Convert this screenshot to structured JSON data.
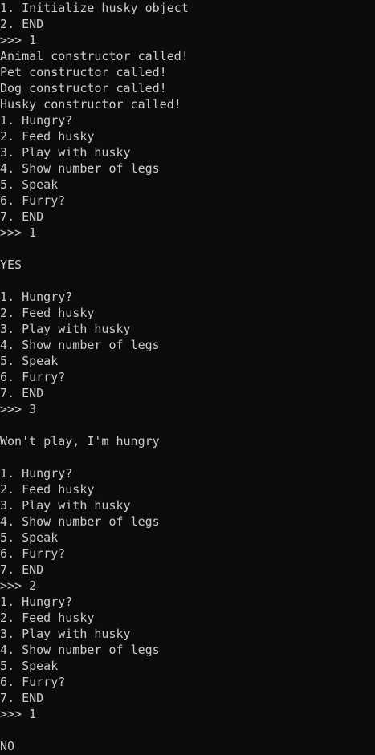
{
  "console": {
    "lines": [
      "1. Initialize husky object",
      "2. END",
      ">>> 1",
      "Animal constructor called!",
      "Pet constructor called!",
      "Dog constructor called!",
      "Husky constructor called!",
      "1. Hungry?",
      "2. Feed husky",
      "3. Play with husky",
      "4. Show number of legs",
      "5. Speak",
      "6. Furry?",
      "7. END",
      ">>> 1",
      "",
      "YES",
      "",
      "1. Hungry?",
      "2. Feed husky",
      "3. Play with husky",
      "4. Show number of legs",
      "5. Speak",
      "6. Furry?",
      "7. END",
      ">>> 3",
      "",
      "Won't play, I'm hungry",
      "",
      "1. Hungry?",
      "2. Feed husky",
      "3. Play with husky",
      "4. Show number of legs",
      "5. Speak",
      "6. Furry?",
      "7. END",
      ">>> 2",
      "1. Hungry?",
      "2. Feed husky",
      "3. Play with husky",
      "4. Show number of legs",
      "5. Speak",
      "6. Furry?",
      "7. END",
      ">>> 1",
      "",
      "NO"
    ],
    "colors": {
      "background": "#0c0c0c",
      "text": "#cccccc"
    }
  }
}
